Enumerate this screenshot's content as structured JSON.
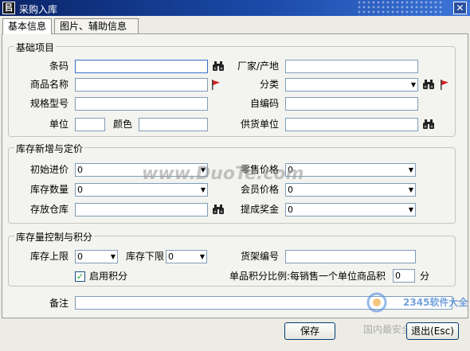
{
  "window": {
    "title": "采购入库",
    "close_glyph": "✕",
    "app_icon_glyph": "㠯"
  },
  "tabs": [
    {
      "label": "基本信息",
      "active": true
    },
    {
      "label": "图片、辅助信息",
      "active": false
    }
  ],
  "basic": {
    "title": "基础项目",
    "barcode_label": "条码",
    "barcode_value": "",
    "name_label": "商品名称",
    "name_value": "",
    "spec_label": "规格型号",
    "spec_value": "",
    "unit_label": "单位",
    "unit_value": "",
    "color_label": "颜色",
    "color_value": "",
    "maker_label": "厂家/产地",
    "maker_value": "",
    "category_label": "分类",
    "category_value": "",
    "selfcode_label": "自编码",
    "selfcode_value": "",
    "supplier_label": "供货单位",
    "supplier_value": ""
  },
  "stock": {
    "title": "库存新增与定价",
    "init_price_label": "初始进价",
    "init_price_value": "0",
    "qty_label": "库存数量",
    "qty_value": "0",
    "warehouse_label": "存放仓库",
    "warehouse_value": "",
    "retail_label": "零售价格",
    "retail_value": "0",
    "member_label": "会员价格",
    "member_value": "0",
    "bonus_label": "提成奖金",
    "bonus_value": "0"
  },
  "control": {
    "title": "库存量控制与积分",
    "upper_label": "库存上限",
    "upper_value": "0",
    "lower_label": "库存下限",
    "lower_value": "0",
    "shelf_label": "货架编号",
    "shelf_value": "",
    "enable_points_label": "启用积分",
    "enable_points_checked": true,
    "check_glyph": "✓",
    "ratio_label": "单品积分比例:每销售一个单位商品积",
    "ratio_value": "0",
    "ratio_unit": "分"
  },
  "remark": {
    "label": "备注",
    "value": ""
  },
  "buttons": {
    "save": "保存",
    "exit": "退出(Esc)"
  },
  "watermark": {
    "text": "www.DuoTe.com",
    "brand": "2345软件大全",
    "brand_sub": "国内最安全的软件站"
  },
  "colors": {
    "titlebar_start": "#0a2468",
    "titlebar_end": "#3c74d8",
    "field_border": "#7f9db9",
    "flag_red": "#d42020"
  }
}
